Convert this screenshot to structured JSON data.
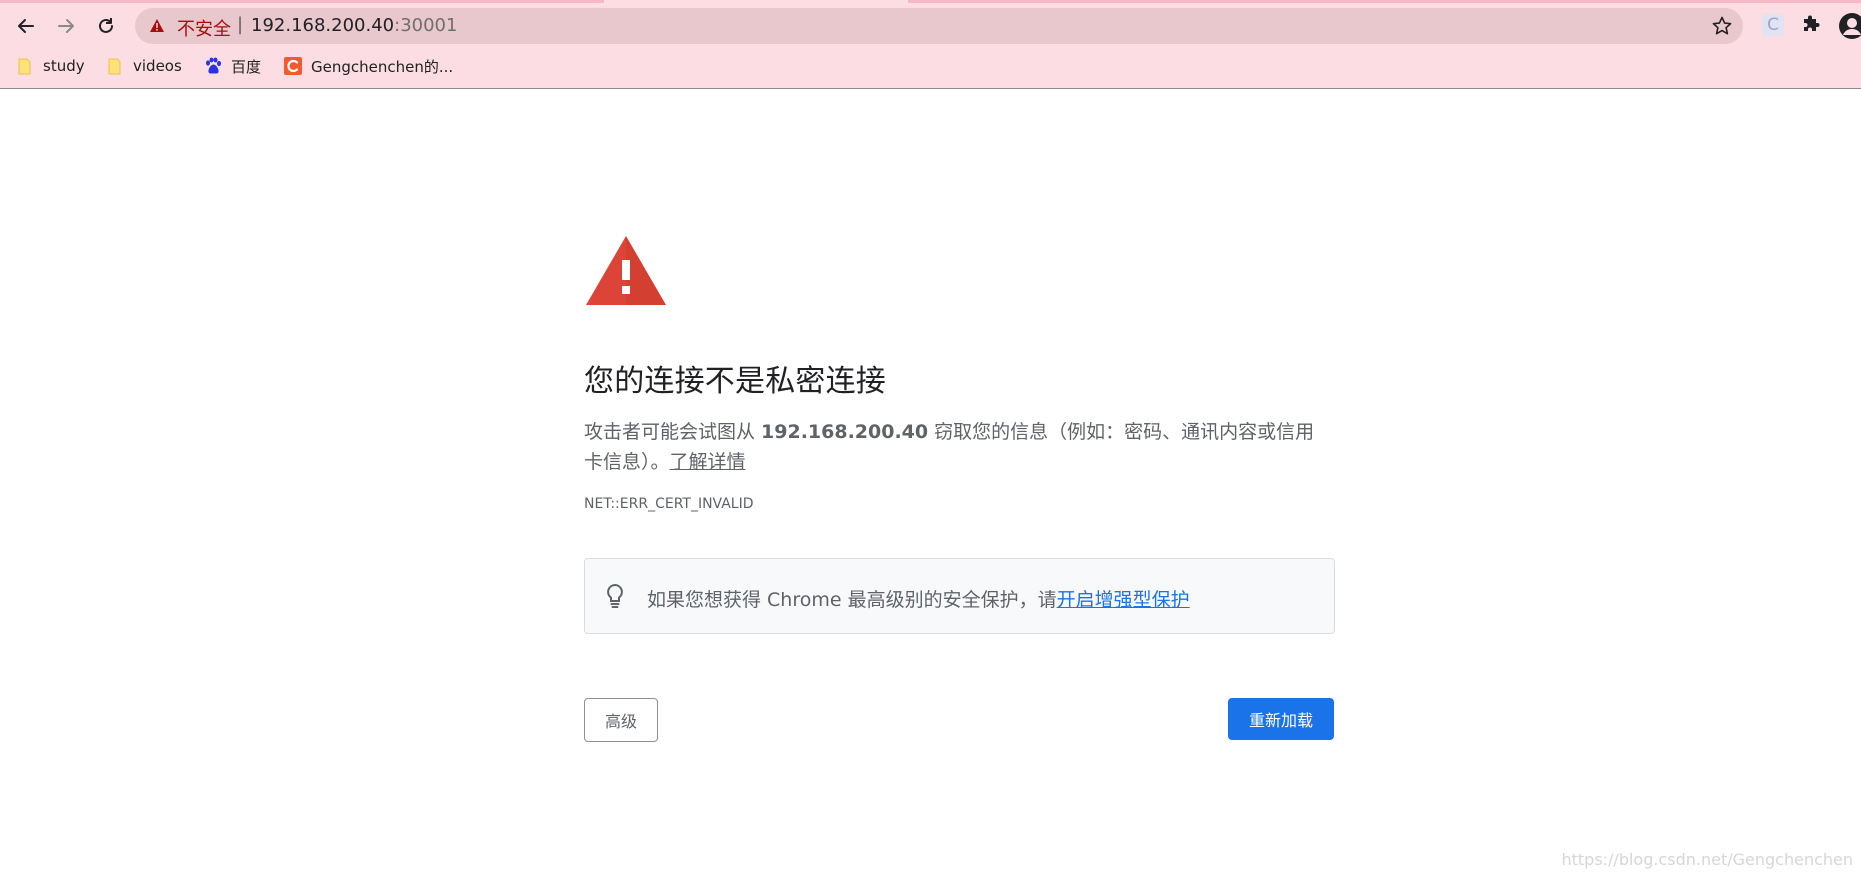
{
  "browser": {
    "omnibox": {
      "security_label": "不安全",
      "separator": "|",
      "host": "192.168.200.40",
      "port": ":30001"
    },
    "extension_letter": "C",
    "bookmarks": [
      {
        "label": "study"
      },
      {
        "label": "videos"
      },
      {
        "label": "百度"
      },
      {
        "label": "Gengchenchen的..."
      }
    ]
  },
  "page": {
    "heading": "您的连接不是私密连接",
    "desc_before": "攻击者可能会试图从 ",
    "desc_host": "192.168.200.40",
    "desc_after": " 窃取您的信息（例如：密码、通讯内容或信用卡信息）。",
    "learn_more": "了解详情",
    "error_code": "NET::ERR_CERT_INVALID",
    "enhanced_text": "如果您想获得 Chrome 最高级别的安全保护，请",
    "enhanced_link": "开启增强型保护",
    "advanced_button": "高级",
    "reload_button": "重新加载"
  },
  "watermark": "https://blog.csdn.net/Gengchenchen",
  "colors": {
    "chrome_bg": "#fcdde3",
    "warning_red": "#db4437",
    "accent_blue": "#1a73e8"
  }
}
